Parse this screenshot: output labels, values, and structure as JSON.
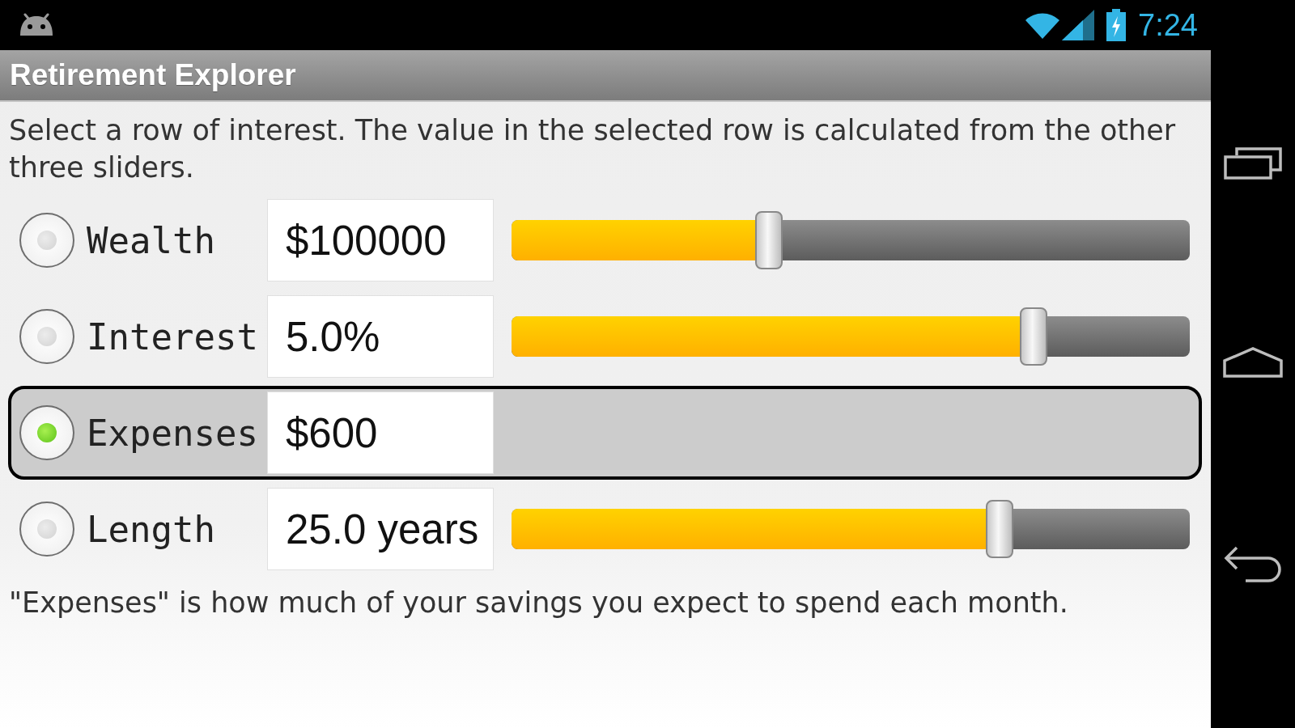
{
  "status_bar": {
    "time": "7:24"
  },
  "app_bar": {
    "title": "Retirement Explorer"
  },
  "instructions": "Select a row of interest. The value in the selected row is calculated from the other three sliders.",
  "rows": [
    {
      "label": "Wealth",
      "value": "$100000",
      "selected": false,
      "level": 0.38
    },
    {
      "label": "Interest",
      "value": "5.0%",
      "selected": false,
      "level": 0.77
    },
    {
      "label": "Expenses",
      "value": "$600",
      "selected": true
    },
    {
      "label": "Length",
      "value": "25.0 years",
      "selected": false,
      "level": 0.72
    }
  ],
  "hint": "\"Expenses\" is how much of your savings you expect to spend each month."
}
